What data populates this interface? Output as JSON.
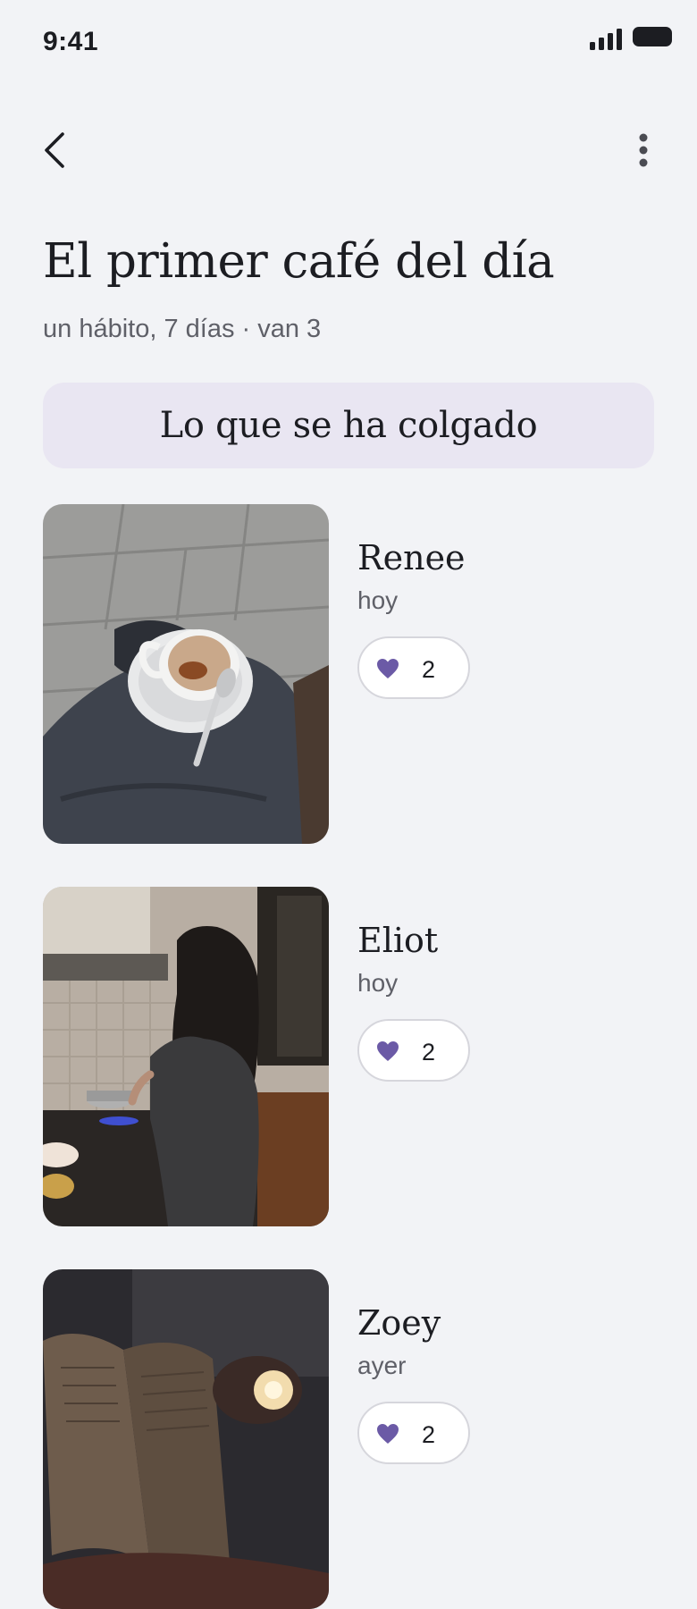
{
  "status_bar": {
    "time": "9:41",
    "signal_icon": "signal-bars-icon",
    "battery_icon": "battery-icon"
  },
  "nav": {
    "back_icon": "chevron-left-icon",
    "more_icon": "more-vertical-icon"
  },
  "header": {
    "title": "El primer café del día",
    "subtitle": "un hábito, 7 días · van 3"
  },
  "section": {
    "title": "Lo que se ha colgado"
  },
  "feed": [
    {
      "name": "Renee",
      "time": "hoy",
      "likes": "2",
      "photo": "coffee-cup-on-lap-photo"
    },
    {
      "name": "Eliot",
      "time": "hoy",
      "likes": "2",
      "photo": "person-cooking-in-kitchen-photo"
    },
    {
      "name": "Zoey",
      "time": "ayer",
      "likes": "2",
      "photo": "book-and-candle-photo"
    }
  ],
  "colors": {
    "background": "#f2f3f6",
    "banner": "#e9e6f2",
    "heart": "#6b5aa6",
    "text": "#1c1d22",
    "muted": "#5f6068"
  }
}
